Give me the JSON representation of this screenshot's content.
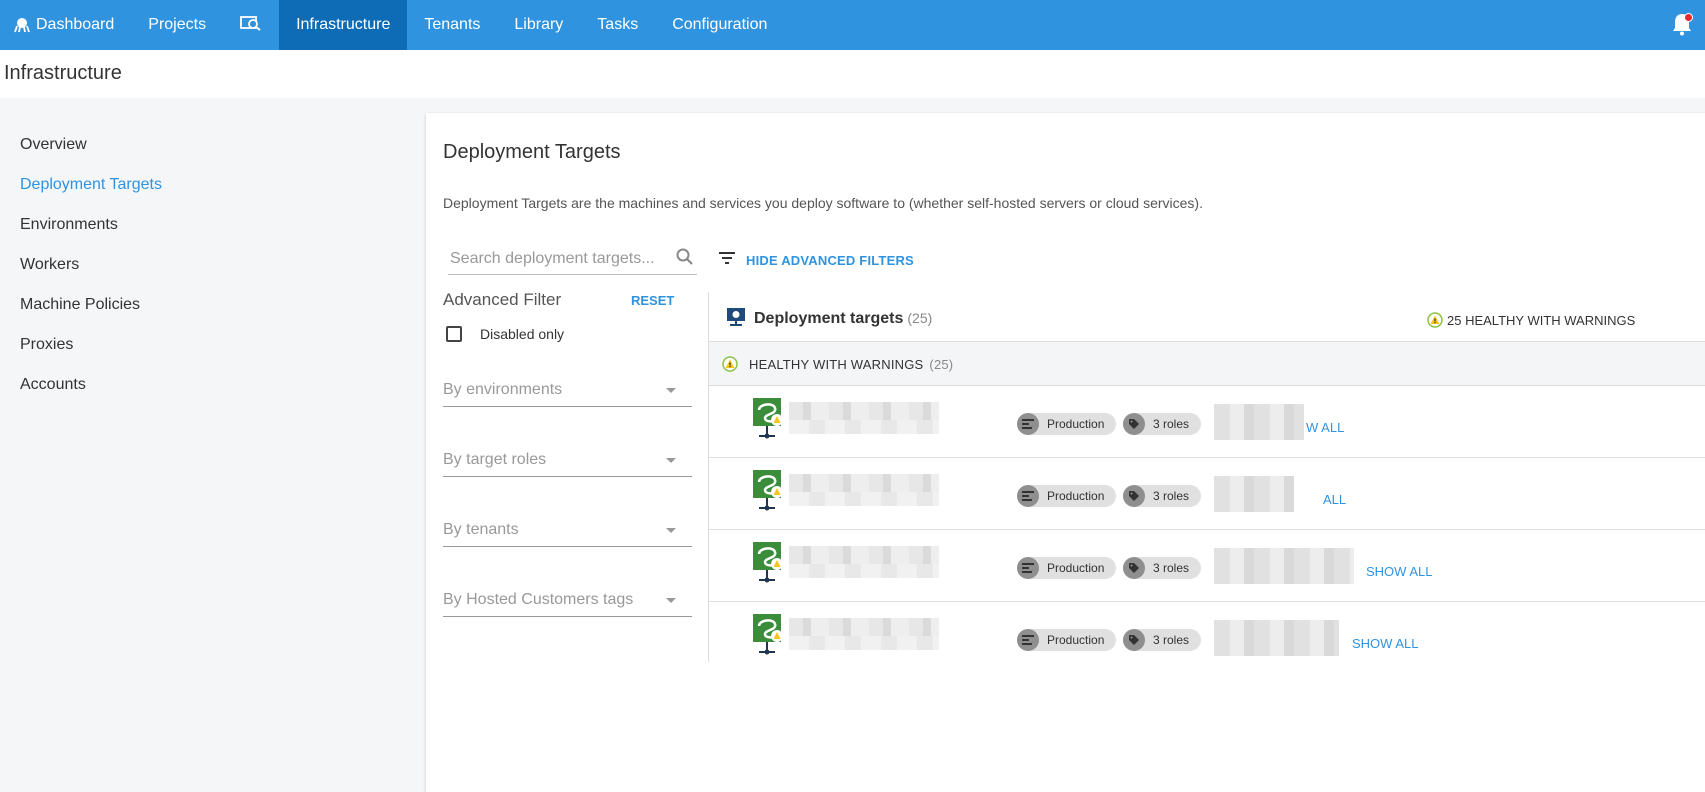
{
  "nav": {
    "items": [
      {
        "label": "Dashboard",
        "icon": "octopus-icon"
      },
      {
        "label": "Projects"
      },
      {
        "label": "",
        "icon": "search-machines-icon"
      },
      {
        "label": "Infrastructure",
        "active": true
      },
      {
        "label": "Tenants"
      },
      {
        "label": "Library"
      },
      {
        "label": "Tasks"
      },
      {
        "label": "Configuration"
      }
    ],
    "notification_icon": "bell-icon",
    "accent_color": "#2f93e0",
    "active_color": "#0e6cb6"
  },
  "page": {
    "title": "Infrastructure"
  },
  "sidebar": {
    "items": [
      {
        "label": "Overview"
      },
      {
        "label": "Deployment Targets",
        "active": true
      },
      {
        "label": "Environments"
      },
      {
        "label": "Workers"
      },
      {
        "label": "Machine Policies"
      },
      {
        "label": "Proxies"
      },
      {
        "label": "Accounts"
      }
    ]
  },
  "main": {
    "title": "Deployment Targets",
    "description": "Deployment Targets are the machines and services you deploy software to (whether self-hosted servers or cloud services).",
    "search_placeholder": "Search deployment targets...",
    "advanced_toggle_label": "HIDE ADVANCED FILTERS"
  },
  "filter": {
    "title": "Advanced Filter",
    "reset_label": "RESET",
    "disabled_only_label": "Disabled only",
    "dropdowns": [
      {
        "label": "By environments"
      },
      {
        "label": "By target roles"
      },
      {
        "label": "By tenants"
      },
      {
        "label": "By Hosted Customers tags"
      }
    ]
  },
  "results": {
    "title": "Deployment targets",
    "count": "(25)",
    "summary": "25 HEALTHY WITH WARNINGS",
    "group_label": "HEALTHY WITH WARNINGS",
    "group_count": "(25)",
    "rows": [
      {
        "environment": "Production",
        "roles": "3 roles",
        "show_all": "W ALL"
      },
      {
        "environment": "Production",
        "roles": "3 roles",
        "show_all": "ALL"
      },
      {
        "environment": "Production",
        "roles": "3 roles",
        "show_all": "SHOW ALL"
      },
      {
        "environment": "Production",
        "roles": "3 roles",
        "show_all": "SHOW ALL"
      }
    ]
  }
}
